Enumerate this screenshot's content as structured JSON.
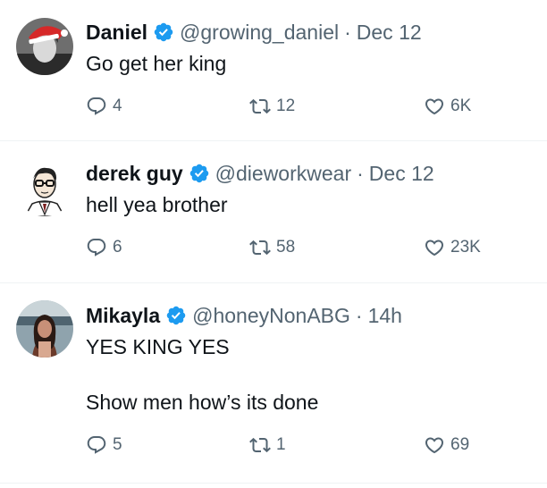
{
  "tweets": [
    {
      "name": "Daniel",
      "handle": "@growing_daniel",
      "dot": "·",
      "date": "Dec 12",
      "lines": [
        "Go get her king"
      ],
      "replies": "4",
      "reposts": "12",
      "likes": "6K"
    },
    {
      "name": "derek guy",
      "handle": "@dieworkwear",
      "dot": "·",
      "date": "Dec 12",
      "lines": [
        "hell yea brother"
      ],
      "replies": "6",
      "reposts": "58",
      "likes": "23K"
    },
    {
      "name": "Mikayla",
      "handle": "@honeyNonABG",
      "dot": "·",
      "date": "14h",
      "lines": [
        "YES KING YES",
        "Show men how’s its done"
      ],
      "replies": "5",
      "reposts": "1",
      "likes": "69"
    }
  ],
  "colors": {
    "verified": "#1d9bf0",
    "muted": "#536471",
    "text": "#0f1419",
    "border": "#eff3f4"
  },
  "icons": {
    "reply": "reply-icon",
    "repost": "repost-icon",
    "like": "heart-icon",
    "verified": "verified-badge-icon"
  }
}
